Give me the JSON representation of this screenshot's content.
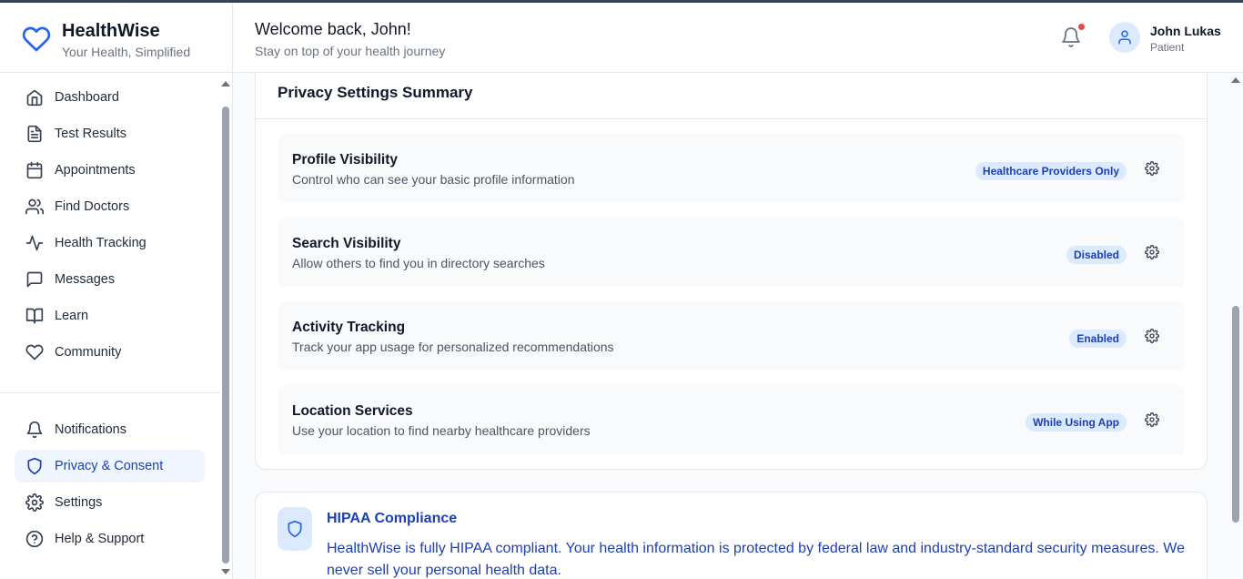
{
  "app": {
    "name": "HealthWise",
    "tagline": "Your Health, Simplified"
  },
  "header": {
    "welcome": "Welcome back, John!",
    "subtitle": "Stay on top of your health journey",
    "user_name": "John Lukas",
    "user_role": "Patient"
  },
  "sidebar": {
    "items": [
      {
        "label": "Dashboard",
        "icon": "home-icon"
      },
      {
        "label": "Test Results",
        "icon": "document-icon"
      },
      {
        "label": "Appointments",
        "icon": "calendar-icon"
      },
      {
        "label": "Find Doctors",
        "icon": "users-icon"
      },
      {
        "label": "Health Tracking",
        "icon": "activity-icon"
      },
      {
        "label": "Messages",
        "icon": "message-icon"
      },
      {
        "label": "Learn",
        "icon": "book-icon"
      },
      {
        "label": "Community",
        "icon": "heart-icon"
      }
    ],
    "bottom_items": [
      {
        "label": "Notifications",
        "icon": "bell-icon"
      },
      {
        "label": "Privacy & Consent",
        "icon": "shield-icon",
        "active": true
      },
      {
        "label": "Settings",
        "icon": "gear-icon"
      },
      {
        "label": "Help & Support",
        "icon": "help-icon"
      }
    ]
  },
  "privacy_summary": {
    "title": "Privacy Settings Summary",
    "settings": [
      {
        "title": "Profile Visibility",
        "description": "Control who can see your basic profile information",
        "status": "Healthcare Providers Only"
      },
      {
        "title": "Search Visibility",
        "description": "Allow others to find you in directory searches",
        "status": "Disabled"
      },
      {
        "title": "Activity Tracking",
        "description": "Track your app usage for personalized recommendations",
        "status": "Enabled"
      },
      {
        "title": "Location Services",
        "description": "Use your location to find nearby healthcare providers",
        "status": "While Using App"
      }
    ]
  },
  "hipaa": {
    "title": "HIPAA Compliance",
    "text": "HealthWise is fully HIPAA compliant. Your health information is protected by federal law and industry-standard security measures. We never sell your personal health data."
  },
  "colors": {
    "accent": "#2563eb",
    "accent_dark": "#1e40af",
    "accent_light": "#dbeafe",
    "notification_dot": "#ef4444"
  }
}
